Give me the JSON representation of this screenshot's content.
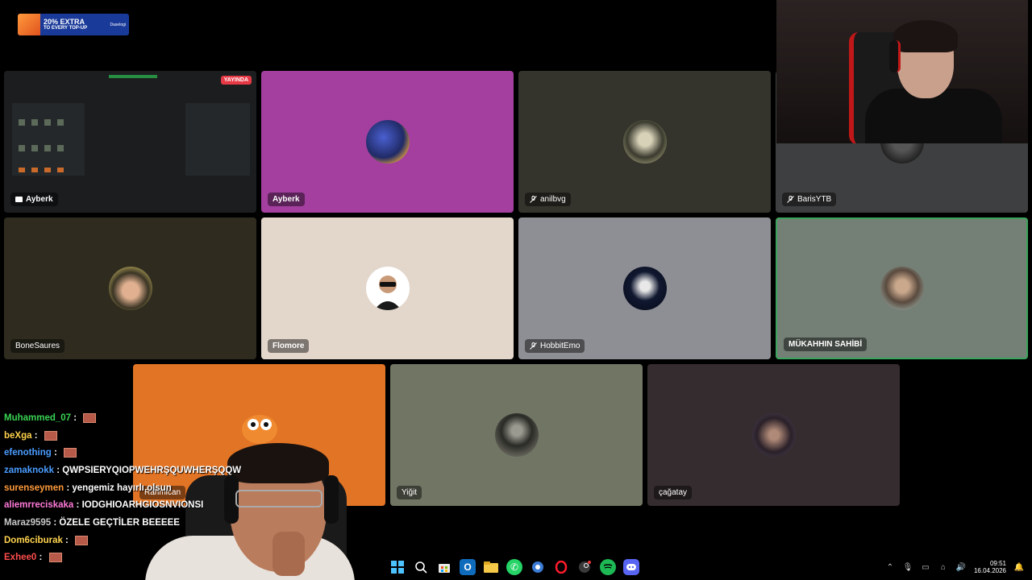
{
  "promo": {
    "headline": "20% EXTRA",
    "subline": "TO EVERY TOP-UP",
    "brand": "Daselogi"
  },
  "tiles": [
    {
      "name": "Ayberk",
      "live_label": "YAYINDA",
      "bg": "#1b1d1f",
      "kind": "screenshare"
    },
    {
      "name": "Ayberk",
      "bg": "#a43f9f",
      "kind": "avatar"
    },
    {
      "name": "anilbvg",
      "bg": "#35342c",
      "kind": "avatar",
      "muted": true
    },
    {
      "name": "BarisYTB",
      "bg": "#3e3f40",
      "kind": "avatar",
      "muted": true
    },
    {
      "name": "BoneSaures",
      "bg": "#2f2c1f",
      "kind": "avatar"
    },
    {
      "name": "Flomore",
      "bg": "#e3d6cb",
      "kind": "avatar"
    },
    {
      "name": "HobbitEmo",
      "bg": "#8e8f94",
      "kind": "avatar",
      "muted": true
    },
    {
      "name": "MÜKAHHIN SAHİBİ",
      "bg": "#747f75",
      "kind": "avatar",
      "speaking": true
    },
    {
      "name": "Rahmican",
      "bg": "#e27425",
      "kind": "avatar"
    },
    {
      "name": "Yiğit",
      "bg": "#707564",
      "kind": "avatar"
    },
    {
      "name": "çağatay",
      "bg": "#352c2f",
      "kind": "avatar"
    }
  ],
  "chat": [
    {
      "user": "Muhammed_07",
      "color": "#39d353",
      "sep": " : ",
      "msg": "",
      "emote": true
    },
    {
      "user": "beXga",
      "color": "#ffd34d",
      "sep": " : ",
      "msg": "",
      "emote": true
    },
    {
      "user": "efenothing",
      "color": "#4a9cff",
      "sep": " : ",
      "msg": "",
      "emote": true
    },
    {
      "user": "zamaknokk",
      "color": "#4a9cff",
      "sep": " : ",
      "msg": "QWPSIERYQIOPWEHRŞQUWHERŞQQW",
      "emote": false
    },
    {
      "user": "surenseymen",
      "color": "#ff9a3c",
      "sep": " : ",
      "msg": "yengemiz hayırlı olsun",
      "emote": false
    },
    {
      "user": "aliemrreciskaka",
      "color": "#ff7ad9",
      "sep": " : ",
      "msg": "IODGHIOARHGIOSNVIONSI",
      "emote": false
    },
    {
      "user": "Maraz9595",
      "color": "#c9c9c9",
      "sep": " : ",
      "msg": "ÖZELE GEÇTİLER BEEEEE",
      "emote": false
    },
    {
      "user": "Dom6ciburak",
      "color": "#ffd34d",
      "sep": " : ",
      "msg": "",
      "emote": true
    },
    {
      "user": "Exhee0",
      "color": "#ff4d4d",
      "sep": " : ",
      "msg": "",
      "emote": true
    }
  ],
  "taskbar": {
    "apps": [
      "windows-start",
      "search",
      "store",
      "outlook",
      "file-explorer",
      "whatsapp",
      "network",
      "opera",
      "steam",
      "spotify",
      "discord"
    ],
    "time": "09:51",
    "date": "16.04.2026"
  }
}
